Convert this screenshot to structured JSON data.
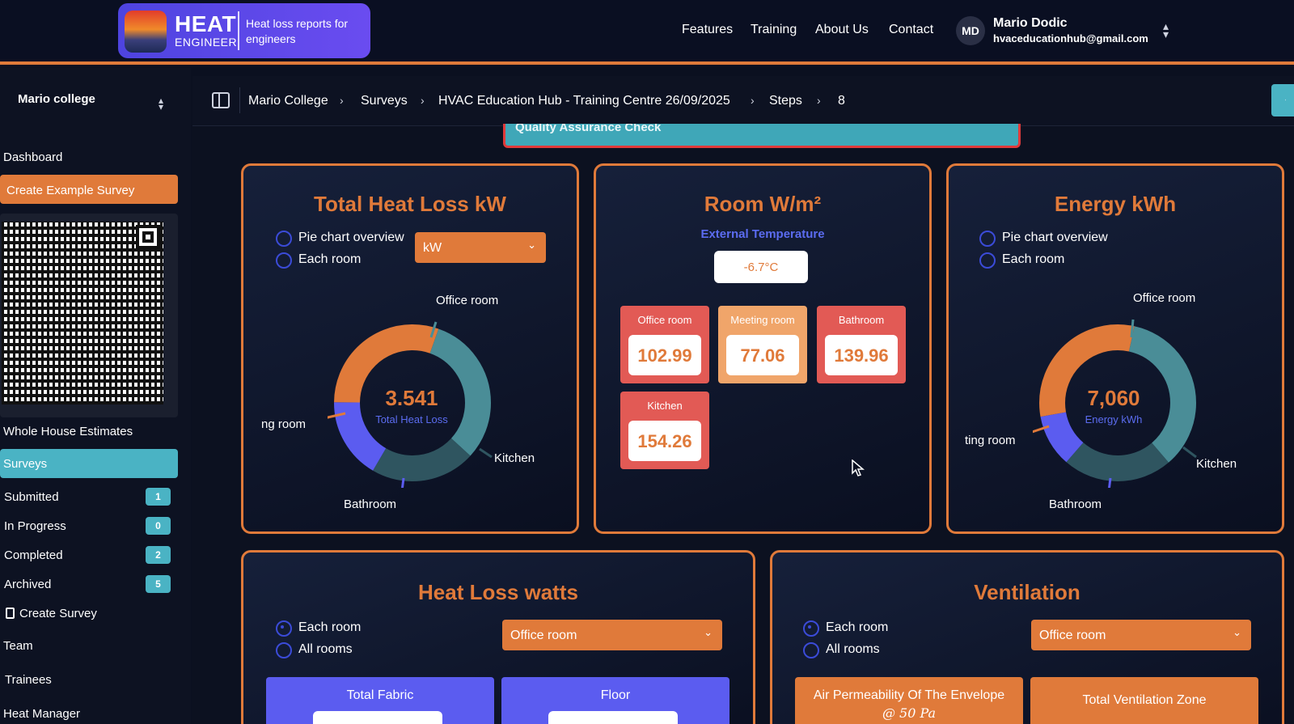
{
  "header": {
    "logo_title": "HEAT",
    "logo_subtitle": "ENGINEER",
    "logo_tagline": "Heat loss reports for engineers",
    "nav": [
      "Features",
      "Training",
      "About Us",
      "Contact"
    ],
    "user": {
      "initials": "MD",
      "name": "Mario Dodic",
      "email": "hvaceducationhub@gmail.com"
    }
  },
  "sidebar": {
    "org": "Mario college",
    "dashboard": "Dashboard",
    "create_example": "Create Example Survey",
    "whole_house": "Whole House Estimates",
    "surveys": "Surveys",
    "statuses": [
      {
        "label": "Submitted",
        "count": "1"
      },
      {
        "label": "In Progress",
        "count": "0"
      },
      {
        "label": "Completed",
        "count": "2"
      },
      {
        "label": "Archived",
        "count": "5"
      }
    ],
    "create_survey": "Create Survey",
    "team": "Team",
    "trainees": "Trainees",
    "heat_manager": "Heat Manager"
  },
  "breadcrumb": [
    "Mario College",
    "Surveys",
    "HVAC Education Hub - Training Centre 26/09/2025",
    "Steps",
    "8"
  ],
  "qa_select": "Quality Assurance Check",
  "total_heat_loss": {
    "title": "Total Heat Loss kW",
    "radio_pie": "Pie chart overview",
    "radio_each": "Each room",
    "unit_select": "kW",
    "center_value": "3.541",
    "center_label": "Total Heat Loss",
    "labels": {
      "office": "Office room",
      "meeting": "ng room",
      "kitchen": "Kitchen",
      "bathroom": "Bathroom"
    }
  },
  "room_wm2": {
    "title": "Room W/m²",
    "ext_temp_label": "External Temperature",
    "ext_temp": "-6.7°C",
    "rooms": [
      {
        "name": "Office room",
        "value": "102.99"
      },
      {
        "name": "Meeting room",
        "value": "77.06"
      },
      {
        "name": "Bathroom",
        "value": "139.96"
      },
      {
        "name": "Kitchen",
        "value": "154.26"
      }
    ]
  },
  "energy": {
    "title": "Energy kWh",
    "radio_pie": "Pie chart overview",
    "radio_each": "Each room",
    "center_value": "7,060",
    "center_label": "Energy kWh",
    "labels": {
      "office": "Office room",
      "meeting": "ting room",
      "kitchen": "Kitchen",
      "bathroom": "Bathroom"
    }
  },
  "heat_loss_watts": {
    "title": "Heat Loss watts",
    "radio_each": "Each room",
    "radio_all": "All rooms",
    "room_select": "Office room",
    "tiles": [
      "Total Fabric",
      "Floor"
    ]
  },
  "ventilation": {
    "title": "Ventilation",
    "radio_each": "Each room",
    "radio_all": "All rooms",
    "room_select": "Office room",
    "tile_air_1": "Air Permeability Of The Envelope",
    "tile_air_2": "@ 50 Pa",
    "tile_zone": "Total Ventilation Zone"
  },
  "colors": {
    "accent_orange": "#e07a3a",
    "teal": "#4ab3c4",
    "indigo": "#5b5cf0",
    "dark_teal": "#2f5560"
  },
  "icons": {
    "sidebar_toggle": "panel-left-icon",
    "back": "chevron-left-icon",
    "select": "chevron-down-icon",
    "user_menu": "chevron-up-down-icon",
    "create_survey": "document-icon"
  }
}
